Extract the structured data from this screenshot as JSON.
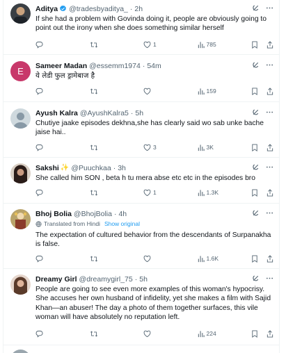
{
  "tweets": [
    {
      "name": "Aditya",
      "handle": "@tradesbyaditya_",
      "time": "2h",
      "verified": true,
      "avatar_color": "#3a3f44",
      "avatar_letter": "",
      "text": "If she had a problem with Govinda doing it, people are obviously going to point out the irony when she does something similar herself",
      "replies": "",
      "retweets": "",
      "likes": "1",
      "views": "785"
    },
    {
      "name": "Sameer Madan",
      "handle": "@essemm1974",
      "time": "54m",
      "verified": false,
      "avatar_color": "#c8386a",
      "avatar_letter": "E",
      "text": "ये लेडी फुल ड्रामेबाज है",
      "replies": "",
      "retweets": "",
      "likes": "",
      "views": "159"
    },
    {
      "name": "Ayush Kalra",
      "handle": "@AyushKalra5",
      "time": "5h",
      "verified": false,
      "avatar_color": "#c9d2d9",
      "avatar_letter": "",
      "text": "Chutiye jaake episodes dekhna,she has clearly said wo sab unke bache jaise hai..",
      "replies": "",
      "retweets": "",
      "likes": "3",
      "views": "3K"
    },
    {
      "name": "Sakshi",
      "name_badge": "✨",
      "handle": "@Puuchkaa",
      "time": "3h",
      "verified": false,
      "avatar_color": "#5b4a45",
      "avatar_letter": "",
      "text": "She called him SON , beta h tu mera abse etc etc in the episodes bro",
      "replies": "",
      "retweets": "",
      "likes": "1",
      "views": "1.3K"
    },
    {
      "name": "Bhoj Bolia",
      "handle": "@BhojBolia",
      "time": "4h",
      "verified": false,
      "avatar_color": "#8e7a4c",
      "avatar_letter": "",
      "translated_label": "Translated from Hindi",
      "show_original": "Show original",
      "text": "The expectation of cultured behavior from the descendants of Surpanakha is false.",
      "replies": "",
      "retweets": "",
      "likes": "",
      "views": "1.6K"
    },
    {
      "name": "Dreamy Girl",
      "handle": "@dreamygirl_75",
      "time": "5h",
      "verified": false,
      "avatar_color": "#b58a70",
      "avatar_letter": "",
      "text": "People are going to see even more examples of this woman's hypocrisy. She accuses her own husband of infidelity, yet she makes a film with Sajid Khan—an abuser! The day a photo of them together surfaces, this vile woman will have absolutely no reputation left.",
      "replies": "",
      "retweets": "",
      "likes": "",
      "views": "224"
    }
  ],
  "colors": {
    "text": "#0f1419",
    "secondary": "#536471",
    "link": "#1d9bf0",
    "border": "#eff3f4"
  },
  "icons": [
    "grok-icon",
    "more-icon",
    "reply-icon",
    "retweet-icon",
    "like-icon",
    "views-icon",
    "bookmark-icon",
    "share-icon",
    "verified-badge-icon"
  ]
}
